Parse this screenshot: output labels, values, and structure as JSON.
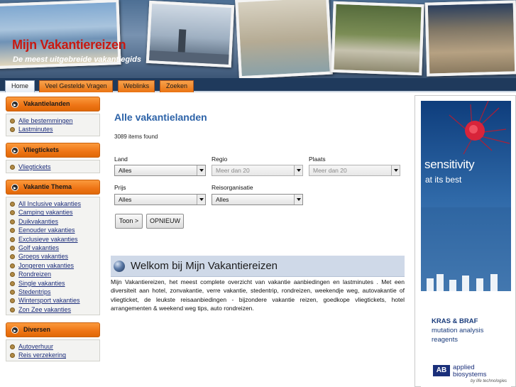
{
  "header": {
    "title": "Mijn Vakantiereizen",
    "subtitle": "De meest uitgebreide vakantiegids"
  },
  "nav": {
    "tabs": [
      {
        "label": "Home",
        "active": true
      },
      {
        "label": "Veel Gestelde Vragen",
        "active": false
      },
      {
        "label": "Weblinks",
        "active": false
      },
      {
        "label": "Zoeken",
        "active": false
      }
    ]
  },
  "sidebar": {
    "vakantielanden": {
      "title": "Vakantielanden",
      "items": [
        "Alle bestemmingen",
        "Lastminutes"
      ]
    },
    "vliegtickets": {
      "title": "Vliegtickets",
      "items": [
        "Vliegtickets"
      ]
    },
    "thema": {
      "title": "Vakantie Thema",
      "items": [
        "All Inclusive vakanties",
        "Camping vakanties",
        "Duikvakanties",
        "Eenouder vakanties",
        "Exclusieve vakanties",
        "Golf vakanties",
        "Groeps vakanties",
        "Jongeren vakanties",
        "Rondreizen",
        "Single vakanties",
        "Stedentrips",
        "Wintersport vakanties",
        "Zon Zee vakanties"
      ]
    },
    "diversen": {
      "title": "Diversen",
      "items": [
        "Autoverhuur",
        "Reis verzekering"
      ]
    }
  },
  "main": {
    "title": "Alle vakantielanden",
    "items_found": "3089 items found",
    "filters": {
      "land": {
        "label": "Land",
        "value": "Alles"
      },
      "regio": {
        "label": "Regio",
        "value": "Meer dan 20"
      },
      "plaats": {
        "label": "Plaats",
        "value": "Meer dan 20"
      },
      "prijs": {
        "label": "Prijs",
        "value": "Alles"
      },
      "reisorganisatie": {
        "label": "Reisorganisatie",
        "value": "Alles"
      }
    },
    "buttons": {
      "show": "Toon >",
      "reset": "OPNIEUW"
    },
    "welcome": {
      "title": "Welkom bij Mijn Vakantiereizen",
      "text": "Mijn Vakantiereizen, het meest complete overzicht van vakantie aanbiedingen en lastminutes . Met een diversiteit aan hotel, zonvakantie, verre vakantie, stedentrip, rondreizen, weekendje weg, autovakantie of vliegticket, de leukste reisaanbiedingen - bijzondere vakantie reizen, goedkope vliegtickets, hotel arrangementen & weekend weg tips, auto rondreizen."
    }
  },
  "ad": {
    "headline": "sensitivity",
    "sub": "at its best",
    "product1": "KRAS & BRAF",
    "product2": "mutation analysis",
    "product3": "reagents",
    "logo_mark": "AB",
    "brand1": "applied",
    "brand2": "biosystems",
    "brand3": "by life technologies"
  },
  "colors": {
    "accent_orange": "#ee7415",
    "title_red": "#c81a12",
    "heading_blue": "#2d63a8",
    "nav_bg": "#1f3a5c",
    "link_blue": "#1b2c7a"
  }
}
